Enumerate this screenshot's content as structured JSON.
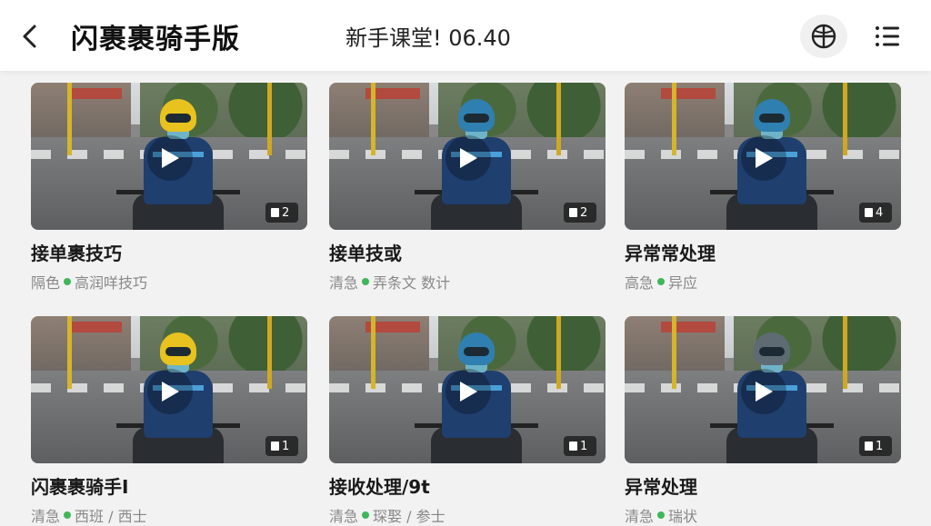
{
  "header": {
    "app_title": "闪裹裹骑手版",
    "page_title": "新手课堂! 06.40",
    "back_icon": "chevron-left-icon",
    "globe_icon": "globe-icon",
    "menu_icon": "list-menu-icon"
  },
  "colors": {
    "accent_green": "#3fb65a",
    "helmet_yellow": "#e8c21e",
    "helmet_blue": "#2f7fb0",
    "helmet_gray": "#5f6b72"
  },
  "cards": [
    {
      "title": "接单裹技巧",
      "meta_left": "隔色",
      "meta_right": "高润咩技巧",
      "badge": "2",
      "helmet": "yellow"
    },
    {
      "title": "接单技或",
      "meta_left": "清急",
      "meta_right": "弄条文  数计",
      "badge": "2",
      "helmet": "blue"
    },
    {
      "title": "异常常处理",
      "meta_left": "高急",
      "meta_right": "异应",
      "badge": "4",
      "helmet": "blue"
    },
    {
      "title": "闪裹裹骑手I",
      "meta_left": "清急",
      "meta_right": "西班 / 西士",
      "badge": "1",
      "helmet": "yellow"
    },
    {
      "title": "接收处理/9t",
      "meta_left": "清急",
      "meta_right": "琛娶 / 参士",
      "badge": "1",
      "helmet": "blue"
    },
    {
      "title": "异常处理",
      "meta_left": "清急",
      "meta_right": "瑞状",
      "badge": "1",
      "helmet": "gray"
    }
  ]
}
